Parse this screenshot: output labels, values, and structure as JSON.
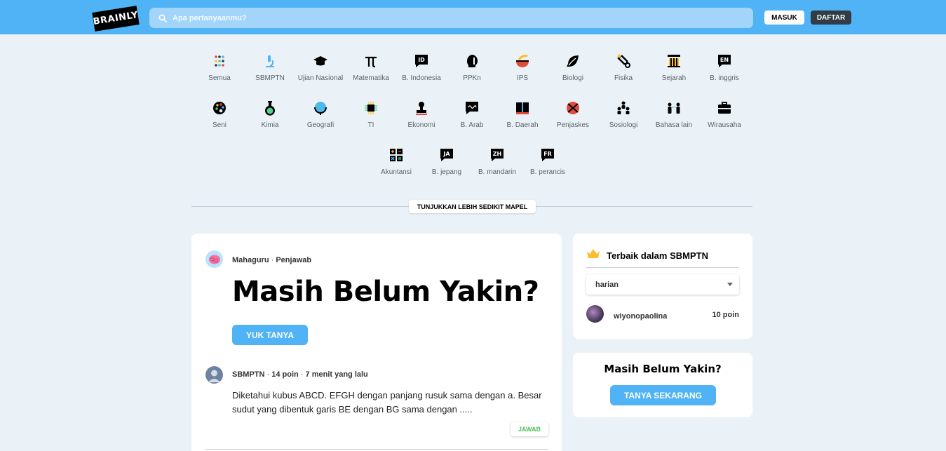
{
  "header": {
    "logo_text": "BRAINLY",
    "search_placeholder": "Apa pertanyaanmu?",
    "login_label": "MASUK",
    "signup_label": "DAFTAR"
  },
  "subjects": [
    {
      "label": "Semua",
      "icon": "dots-grid-icon"
    },
    {
      "label": "SBMPTN",
      "icon": "microscope-icon"
    },
    {
      "label": "Ujian Nasional",
      "icon": "graduation-cap-icon"
    },
    {
      "label": "Matematika",
      "icon": "pi-icon"
    },
    {
      "label": "B. Indonesia",
      "icon": "id-bubble-icon"
    },
    {
      "label": "PPKn",
      "icon": "head-icon"
    },
    {
      "label": "IPS",
      "icon": "bowl-icon"
    },
    {
      "label": "Biologi",
      "icon": "leaf-icon"
    },
    {
      "label": "Fisika",
      "icon": "magnet-icon"
    },
    {
      "label": "Sejarah",
      "icon": "column-icon"
    },
    {
      "label": "B. inggris",
      "icon": "en-bubble-icon"
    },
    {
      "label": "Seni",
      "icon": "palette-icon"
    },
    {
      "label": "Kimia",
      "icon": "flask-icon"
    },
    {
      "label": "Geografi",
      "icon": "globe-icon"
    },
    {
      "label": "TI",
      "icon": "chip-icon"
    },
    {
      "label": "Ekonomi",
      "icon": "stamp-icon"
    },
    {
      "label": "B. Arab",
      "icon": "arab-bubble-icon"
    },
    {
      "label": "B. Daerah",
      "icon": "book-icon"
    },
    {
      "label": "Penjaskes",
      "icon": "ball-icon"
    },
    {
      "label": "Sosiologi",
      "icon": "people-icon"
    },
    {
      "label": "Bahasa lain",
      "icon": "speakers-icon"
    },
    {
      "label": "Wirausaha",
      "icon": "briefcase-icon"
    },
    {
      "label": "Akuntansi",
      "icon": "calculator-icon"
    },
    {
      "label": "B. jepang",
      "icon": "ja-bubble-icon"
    },
    {
      "label": "B. mandarin",
      "icon": "zh-bubble-icon"
    },
    {
      "label": "B. perancis",
      "icon": "fr-bubble-icon"
    }
  ],
  "icon_text": {
    "id": "ID",
    "en": "EN",
    "ja": "JA",
    "zh": "ZH",
    "fr": "FR"
  },
  "toggle_subjects_label": "TUNJUKKAN LEBIH SEDIKIT MAPEL",
  "promo": {
    "author": "Mahaguru",
    "role": "Penjawab",
    "title": "Masih Belum Yakin?",
    "button": "YUK TANYA"
  },
  "question": {
    "subject": "SBMPTN",
    "points": "14 poin",
    "time": "7 menit yang lalu",
    "text": "Diketahui kubus ABCD. EFGH dengan panjang rusuk sama dengan a. Besar sudut yang dibentuk garis BE dengan BG sama dengan .....",
    "answer_button": "JAWAB"
  },
  "ranking": {
    "title": "Terbaik dalam SBMPTN",
    "period": "harian",
    "users": [
      {
        "name": "wiyonopaolina",
        "points": "10 poin"
      }
    ]
  },
  "cta": {
    "title": "Masih Belum Yakin?",
    "button": "TANYA SEKARANG"
  },
  "colors": {
    "primary": "#4fb3f6",
    "background": "#ebf2f7",
    "dark_button": "#323c45",
    "answer_green": "#4ec257"
  }
}
